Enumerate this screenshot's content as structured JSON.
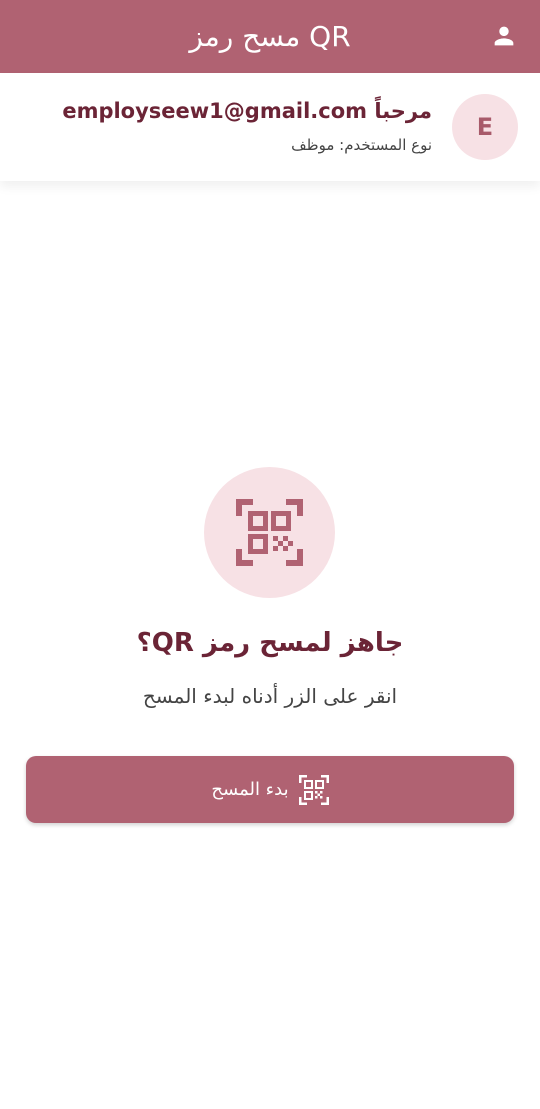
{
  "app_bar": {
    "title": "مسح رمز QR",
    "profile_icon": "person-icon",
    "color": "#b06272"
  },
  "user_card": {
    "avatar_initial": "E",
    "welcome_prefix": "مرحباً",
    "email": "employseew1@gmail.com",
    "user_type": "نوع المستخدم: موظف"
  },
  "main": {
    "qr_icon": "qr-code-scan-icon",
    "title": "جاهز لمسح رمز QR؟",
    "subtitle": "انقر على الزر أدناه لبدء المسح"
  },
  "start_button": {
    "label": "بدء المسح",
    "icon": "qr-code-icon"
  },
  "colors": {
    "primary": "#b06272",
    "primary_light": "#f7e1e5",
    "title_text": "#6b2436"
  }
}
